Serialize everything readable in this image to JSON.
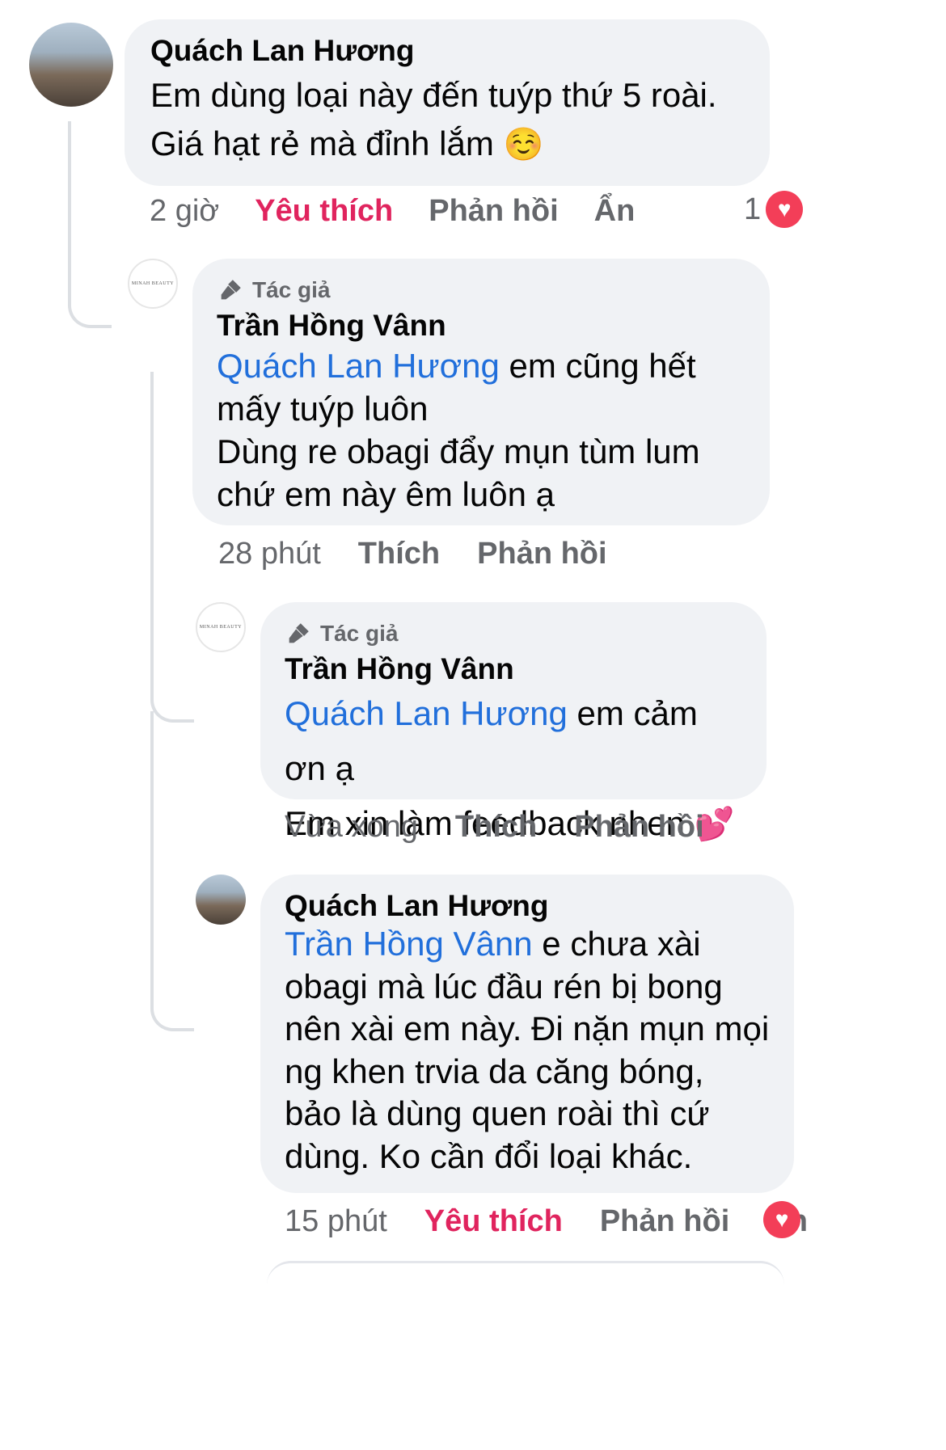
{
  "comments": [
    {
      "author": "Quách Lan Hương",
      "text": "Em dùng loại này đến tuýp thứ 5 roài. Giá hạt rẻ mà đỉnh lắm",
      "emoji": "☺️",
      "time": "2 giờ",
      "like_label": "Yêu thích",
      "reply_label": "Phản hồi",
      "hide_label": "Ẩn",
      "reaction_count": "1"
    },
    {
      "author_badge": "Tác giả",
      "author": "Trần Hồng Vânn",
      "mention": "Quách Lan Hương",
      "text_after_mention": " em cũng hết mấy tuýp luôn",
      "text_line2": "Dùng re obagi đẩy mụn tùm lum chứ em này êm luôn ạ",
      "time": "28 phút",
      "like_label": "Thích",
      "reply_label": "Phản hồi"
    },
    {
      "author_badge": "Tác giả",
      "author": "Trần Hồng Vânn",
      "mention": "Quách Lan Hương",
      "text_after_mention": " em cảm ơn ạ",
      "text_line2": "Em xin làm feedback nhen",
      "emoji": "💕",
      "time": "Vừa xong",
      "like_label": "Thích",
      "reply_label": "Phản hồi"
    },
    {
      "author": "Quách Lan Hương",
      "mention": "Trần Hồng Vânn",
      "text_after_mention": "  e chưa xài obagi mà lúc đầu rén bị bong nên xài em này. Đi nặn mụn mọi ng khen trvia da căng bóng, bảo là dùng quen roài thì cứ dùng. Ko cần đổi loại khác.",
      "time": "15 phút",
      "like_label": "Yêu thích",
      "reply_label": "Phản hồi",
      "hide_label": "Ẩn"
    }
  ],
  "logo": {
    "text": "MINAH BEAUTY"
  },
  "colors": {
    "like_active": "#e0245e",
    "mention": "#216fdb",
    "bubble": "#f0f2f5",
    "heart": "#f33e58"
  }
}
